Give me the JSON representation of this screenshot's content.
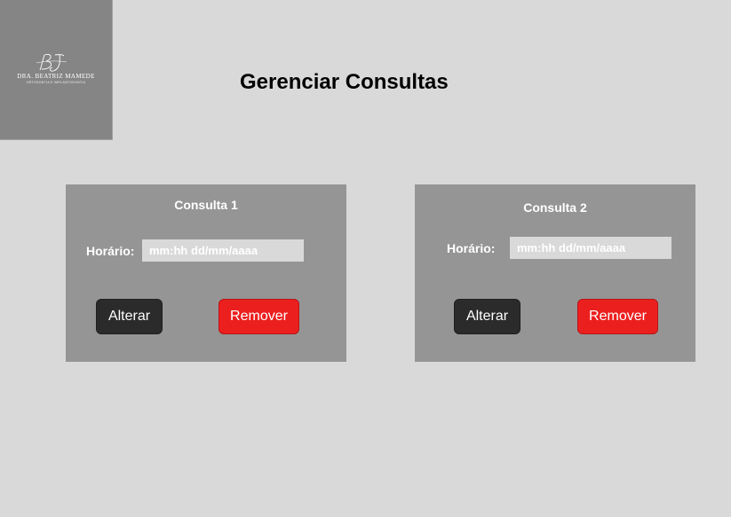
{
  "logo": {
    "monogram": "BJ",
    "name": "DRA. BEATRIZ MAMEDE",
    "subtitle": "ORTODONTIA E IMPLANTODONTIA"
  },
  "page": {
    "title": "Gerenciar Consultas"
  },
  "consultas": [
    {
      "title": "Consulta 1",
      "label": "Horário:",
      "placeholder": "mm:hh dd/mm/aaaa",
      "alter_label": "Alterar",
      "remove_label": "Remover"
    },
    {
      "title": "Consulta 2",
      "label": "Horário:",
      "placeholder": "mm:hh dd/mm/aaaa",
      "alter_label": "Alterar",
      "remove_label": "Remover"
    }
  ],
  "colors": {
    "background": "#d9d9d9",
    "logo_bg": "#858585",
    "card_bg": "#959595",
    "alter_button": "#2b2b2b",
    "remove_button": "#ec1f1f"
  }
}
